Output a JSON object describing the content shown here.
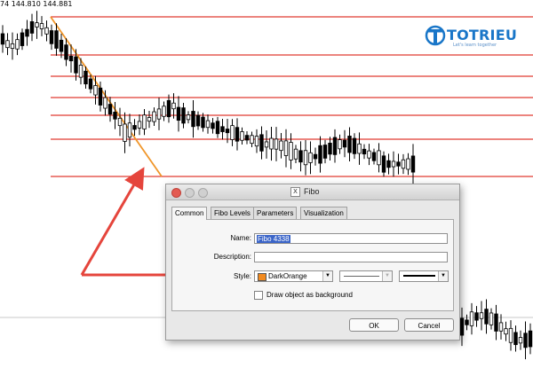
{
  "quote_text": "74 144.810 144.881",
  "logo": {
    "name": "TOTRIEU",
    "tagline": "Let's learn together"
  },
  "chart_colors": {
    "levels": "#e03a32",
    "fib_line": "#f0962a",
    "arrow": "#e5453c",
    "candles": "#000000"
  },
  "dialog": {
    "title": "Fibo",
    "title_icon": "X",
    "tabs": [
      {
        "label": "Common",
        "active": true
      },
      {
        "label": "Fibo Levels",
        "active": false
      },
      {
        "label": "Parameters",
        "active": false
      },
      {
        "label": "Visualization",
        "active": false
      }
    ],
    "name_label": "Name:",
    "name_value": "Fibo 4338",
    "description_label": "Description:",
    "description_value": "",
    "style_label": "Style:",
    "color_value": "DarkOrange",
    "color_hex": "#f28a1e",
    "background_checkbox_label": "Draw object as background",
    "background_checked": false,
    "ok_label": "OK",
    "cancel_label": "Cancel"
  }
}
